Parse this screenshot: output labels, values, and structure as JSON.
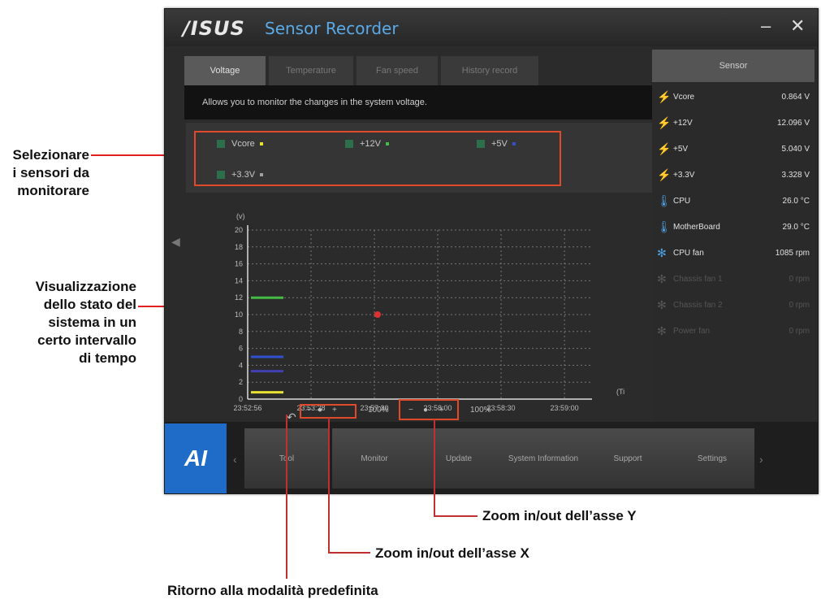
{
  "callouts": {
    "select_sensors": "Selezionare\ni sensori da\nmonitorare",
    "state_view": "Visualizzazione\ndello stato del\nsistema in un\ncerto intervallo\ndi tempo",
    "zoom_y": "Zoom in/out dell’asse Y",
    "zoom_x": "Zoom in/out dell’asse X",
    "default_mode": "Ritorno alla modalità predefinita"
  },
  "window": {
    "logo": "/ISUS",
    "title": "Sensor Recorder",
    "minimize": "–",
    "close": "✕"
  },
  "tabs": [
    {
      "label": "Voltage"
    },
    {
      "label": "Temperature"
    },
    {
      "label": "Fan speed"
    },
    {
      "label": "History record"
    }
  ],
  "description": "Allows you to monitor the changes in the system voltage.",
  "sensor_checks": [
    {
      "label": "Vcore",
      "color": "#e8e030"
    },
    {
      "label": "+12V",
      "color": "#40c040"
    },
    {
      "label": "+5V",
      "color": "#3050d0"
    },
    {
      "label": "+3.3V",
      "color": "#a0a0a0"
    }
  ],
  "chart_data": {
    "type": "line",
    "ylabel": "(v)",
    "xlabel": "(Time)",
    "ylim": [
      0,
      20
    ],
    "yticks": [
      "0",
      "2",
      "4",
      "6",
      "8",
      "10",
      "12",
      "14",
      "16",
      "18",
      "20"
    ],
    "x": [
      "23:52:56",
      "23:53:28",
      "23:57:30",
      "23:58:00",
      "23:58:30",
      "23:59:00"
    ],
    "series": [
      {
        "name": "+12V",
        "color": "#44bb44",
        "values": [
          12.0,
          12.0
        ]
      },
      {
        "name": "+5V",
        "color": "#3050d0",
        "values": [
          5.0,
          5.0
        ]
      },
      {
        "name": "+3.3V",
        "color": "#4040b0",
        "values": [
          3.3,
          3.3
        ]
      },
      {
        "name": "Vcore",
        "color": "#e8e030",
        "values": [
          0.8,
          0.8
        ]
      }
    ],
    "grid": true
  },
  "zoom": {
    "x_level": "100%",
    "y_level": "100%"
  },
  "sensors": {
    "header": "Sensor",
    "items": [
      {
        "name": "Vcore",
        "value": "0.864 V",
        "icon": "bolt-icon",
        "dim": false
      },
      {
        "name": "+12V",
        "value": "12.096 V",
        "icon": "bolt-icon",
        "dim": false
      },
      {
        "name": "+5V",
        "value": "5.040 V",
        "icon": "bolt-icon",
        "dim": false
      },
      {
        "name": "+3.3V",
        "value": "3.328 V",
        "icon": "bolt-icon",
        "dim": false
      },
      {
        "name": "CPU",
        "value": "26.0 °C",
        "icon": "thermometer-icon",
        "dim": false
      },
      {
        "name": "MotherBoard",
        "value": "29.0 °C",
        "icon": "thermometer-icon",
        "dim": false
      },
      {
        "name": "CPU fan",
        "value": "1085 rpm",
        "icon": "fan-icon",
        "dim": false
      },
      {
        "name": "Chassis fan 1",
        "value": "0 rpm",
        "icon": "fan-icon",
        "dim": true
      },
      {
        "name": "Chassis fan 2",
        "value": "0 rpm",
        "icon": "fan-icon",
        "dim": true
      },
      {
        "name": "Power fan",
        "value": "0 rpm",
        "icon": "fan-icon",
        "dim": true
      }
    ]
  },
  "nav": [
    {
      "label": "Tool"
    },
    {
      "label": "Monitor"
    },
    {
      "label": "Update"
    },
    {
      "label": "System Information"
    },
    {
      "label": "Support"
    },
    {
      "label": "Settings"
    }
  ],
  "brand_logo": "AI"
}
